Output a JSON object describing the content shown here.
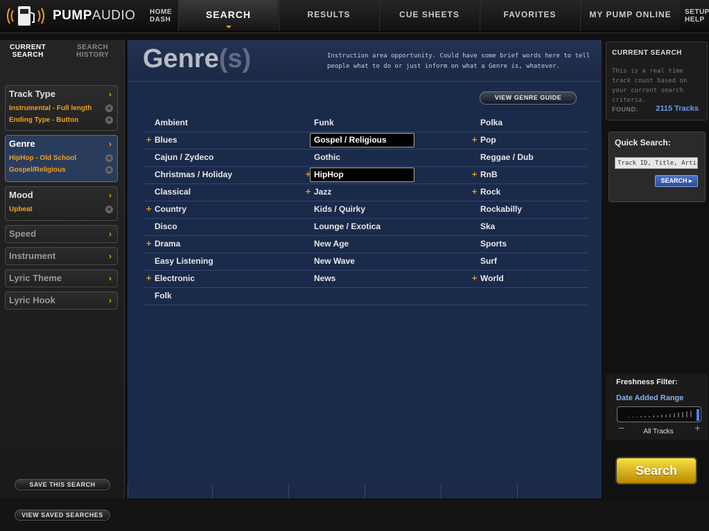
{
  "brand": {
    "name_bold": "PUMP",
    "name_rest": "AUDIO"
  },
  "nav": {
    "home_dash": {
      "line1": "HOME",
      "line2": "DASH"
    },
    "tabs": [
      {
        "label": "SEARCH"
      },
      {
        "label": "RESULTS"
      },
      {
        "label": "CUE SHEETS"
      },
      {
        "label": "FAVORITES"
      },
      {
        "label": "MY PUMP ONLINE"
      }
    ],
    "setup_help": {
      "line1": "SETUP",
      "line2": "HELP"
    }
  },
  "left": {
    "tab_current": {
      "line1": "CURRENT",
      "line2": "SEARCH"
    },
    "tab_history": {
      "line1": "SEARCH",
      "line2": "HISTORY"
    },
    "categories": [
      {
        "label": "Track Type",
        "items": [
          "Instrumental - Full length",
          "Ending Type - Button"
        ]
      },
      {
        "label": "Genre",
        "items": [
          "HipHop - Old School",
          "Gospel/Religious"
        ]
      },
      {
        "label": "Mood",
        "items": [
          "Upbeat"
        ]
      },
      {
        "label": "Speed",
        "items": []
      },
      {
        "label": "Instrument",
        "items": []
      },
      {
        "label": "Lyric Theme",
        "items": []
      },
      {
        "label": "Lyric Hook",
        "items": []
      }
    ],
    "save_search": "SAVE THIS SEARCH",
    "view_saved": "VIEW SAVED SEARCHES"
  },
  "main": {
    "title_main": "Genre",
    "title_open": "(",
    "title_s": "s",
    "title_close": ")",
    "instruction": "Instruction area opportunity. Could have some brief words here to tell people what to do or just inform on what a Genre is, whatever.",
    "guide_button": "VIEW GENRE GUIDE",
    "genres": [
      [
        {
          "label": "Ambient",
          "plus": false,
          "selected": false
        },
        {
          "label": "Funk",
          "plus": false,
          "selected": false
        },
        {
          "label": "Polka",
          "plus": false,
          "selected": false
        }
      ],
      [
        {
          "label": "Blues",
          "plus": true,
          "selected": false
        },
        {
          "label": "Gospel / Religious",
          "plus": false,
          "selected": true
        },
        {
          "label": "Pop",
          "plus": true,
          "selected": false
        }
      ],
      [
        {
          "label": "Cajun / Zydeco",
          "plus": false,
          "selected": false
        },
        {
          "label": "Gothic",
          "plus": false,
          "selected": false
        },
        {
          "label": "Reggae / Dub",
          "plus": false,
          "selected": false
        }
      ],
      [
        {
          "label": "Christmas / Holiday",
          "plus": false,
          "selected": false
        },
        {
          "label": "HipHop",
          "plus": true,
          "selected": true
        },
        {
          "label": "RnB",
          "plus": true,
          "selected": false
        }
      ],
      [
        {
          "label": "Classical",
          "plus": false,
          "selected": false
        },
        {
          "label": "Jazz",
          "plus": true,
          "selected": false
        },
        {
          "label": "Rock",
          "plus": true,
          "selected": false
        }
      ],
      [
        {
          "label": "Country",
          "plus": true,
          "selected": false
        },
        {
          "label": "Kids / Quirky",
          "plus": false,
          "selected": false
        },
        {
          "label": "Rockabilly",
          "plus": false,
          "selected": false
        }
      ],
      [
        {
          "label": "Disco",
          "plus": false,
          "selected": false
        },
        {
          "label": "Lounge / Exotica",
          "plus": false,
          "selected": false
        },
        {
          "label": "Ska",
          "plus": false,
          "selected": false
        }
      ],
      [
        {
          "label": "Drama",
          "plus": true,
          "selected": false
        },
        {
          "label": "New Age",
          "plus": false,
          "selected": false
        },
        {
          "label": "Sports",
          "plus": false,
          "selected": false
        }
      ],
      [
        {
          "label": "Easy Listening",
          "plus": false,
          "selected": false
        },
        {
          "label": "New Wave",
          "plus": false,
          "selected": false
        },
        {
          "label": "Surf",
          "plus": false,
          "selected": false
        }
      ],
      [
        {
          "label": "Electronic",
          "plus": true,
          "selected": false
        },
        {
          "label": "News",
          "plus": false,
          "selected": false
        },
        {
          "label": "World",
          "plus": true,
          "selected": false
        }
      ],
      [
        {
          "label": "Folk",
          "plus": false,
          "selected": false
        },
        null,
        null
      ]
    ]
  },
  "right": {
    "current_search": {
      "title": "CURRENT SEARCH",
      "description": "This is a real time track count based on your current search criteria.",
      "found_label": "FOUND:",
      "found_count": "2115 Tracks"
    },
    "quick_search": {
      "title": "Quick Search:",
      "input_value": "Track ID, Title, Artist",
      "button": "SEARCH"
    },
    "freshness": {
      "title": "Freshness Filter:",
      "subtitle": "Date Added Range",
      "value_label": "All Tracks",
      "level": 1.0,
      "min_symbol": "−",
      "max_symbol": "+"
    },
    "search_button": "Search"
  },
  "colors": {
    "accent": "#f0a020",
    "main_bg": "#1a2a4a",
    "link_blue": "#6a9cf0"
  }
}
